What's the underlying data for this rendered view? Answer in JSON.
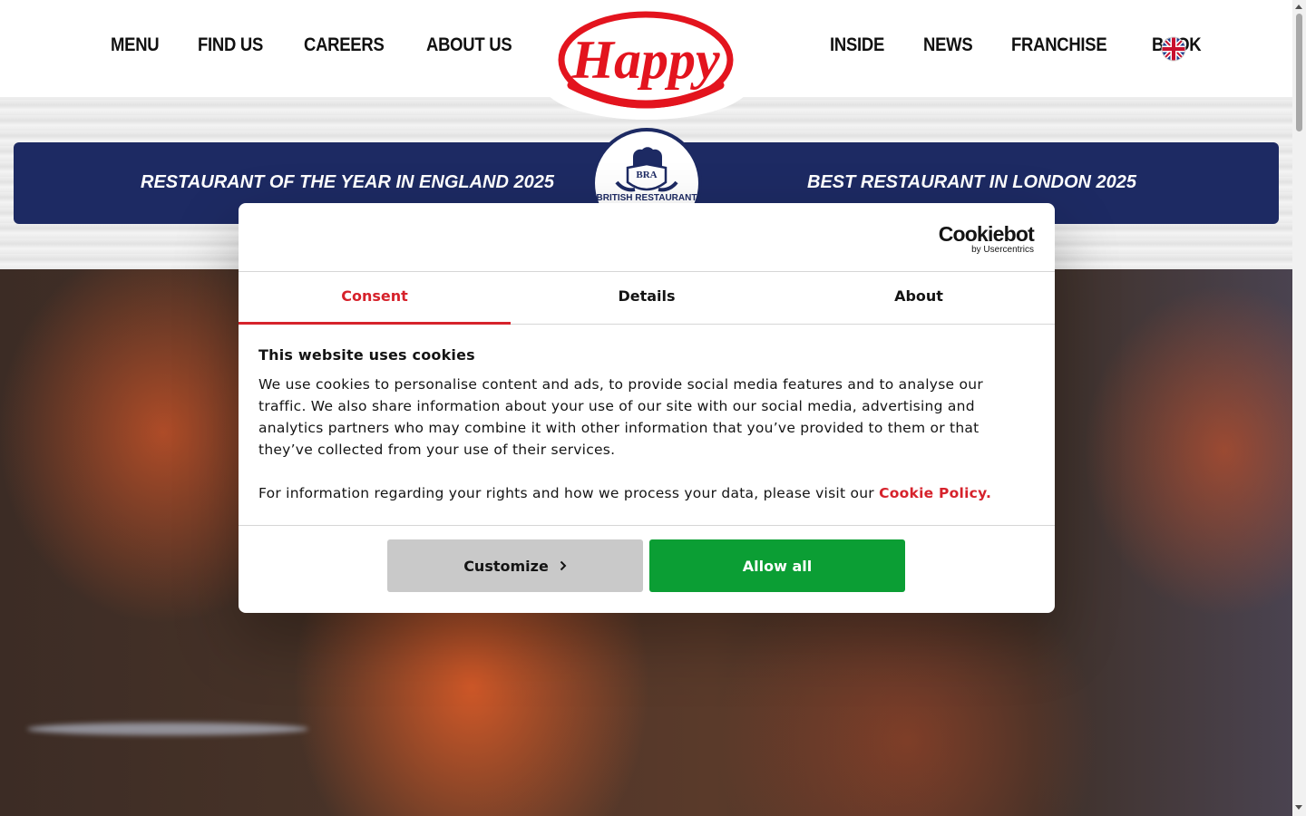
{
  "header": {
    "nav_left": [
      "MENU",
      "FIND US",
      "CAREERS",
      "ABOUT US"
    ],
    "nav_right": [
      "INSIDE",
      "NEWS",
      "FRANCHISE",
      "BOOK"
    ],
    "logo_text": "Happy",
    "flag_icon": "uk-flag-icon"
  },
  "awards": {
    "left": "RESTAURANT OF THE YEAR IN ENGLAND 2025",
    "right": "BEST RESTAURANT IN LONDON 2025",
    "badge_initials": "BRA",
    "badge_text": "BRITISH RESTAURANT"
  },
  "cookie_dialog": {
    "brand": "Cookiebot",
    "brand_sub": "by Usercentrics",
    "tabs": [
      "Consent",
      "Details",
      "About"
    ],
    "active_tab": "Consent",
    "title": "This website uses cookies",
    "body": "We use cookies to personalise content and ads, to provide social media features and to analyse our traffic. We also share information about your use of our site with our social media, advertising and analytics partners who may combine it with other information that you’ve provided to them or that they’ve collected from your use of their services.",
    "info_text": "For information regarding your rights and how we process your data, please visit our ",
    "link_text": "Cookie Policy.",
    "customize_label": "Customize",
    "allow_label": "Allow all"
  },
  "colors": {
    "brand_red": "#d6222b",
    "navy": "#1d2a63",
    "allow_green": "#0b9e34",
    "customize_gray": "#c9c9c9"
  }
}
